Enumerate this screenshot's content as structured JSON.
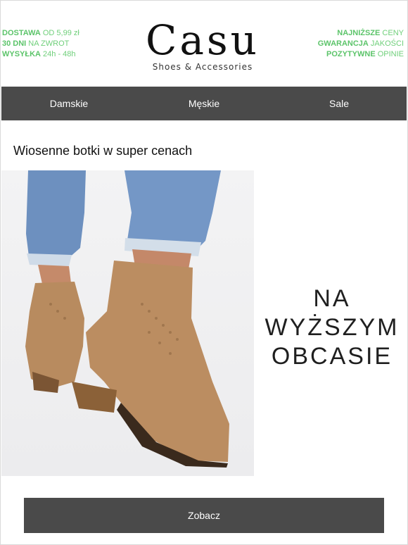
{
  "header": {
    "left": [
      {
        "bold": "DOSTAWA",
        "text": " OD 5,99 zł"
      },
      {
        "bold": "30 DNI",
        "text": " NA ZWROT"
      },
      {
        "bold": "WYSYŁKA",
        "text": " 24h - 48h"
      }
    ],
    "right": [
      {
        "bold": "NAJNIŻSZE",
        "text": " CENY"
      },
      {
        "bold": "GWARANCJA",
        "text": " JAKOŚCI"
      },
      {
        "bold": "POZYTYWNE",
        "text": " OPINIE"
      }
    ],
    "logo": {
      "word": "Casu",
      "subtitle": "Shoes & Accessories"
    }
  },
  "nav": {
    "items": [
      "Damskie",
      "Męskie",
      "Sale"
    ]
  },
  "main": {
    "title": "Wiosenne botki w super cenach",
    "promo_lines": [
      "NA",
      "WYŻSZYM",
      "OBCASIE"
    ],
    "cta_label": "Zobacz"
  },
  "colors": {
    "accent_green": "#6fcf7a",
    "bar": "#4a4a4a",
    "suede": "#b98d62"
  }
}
